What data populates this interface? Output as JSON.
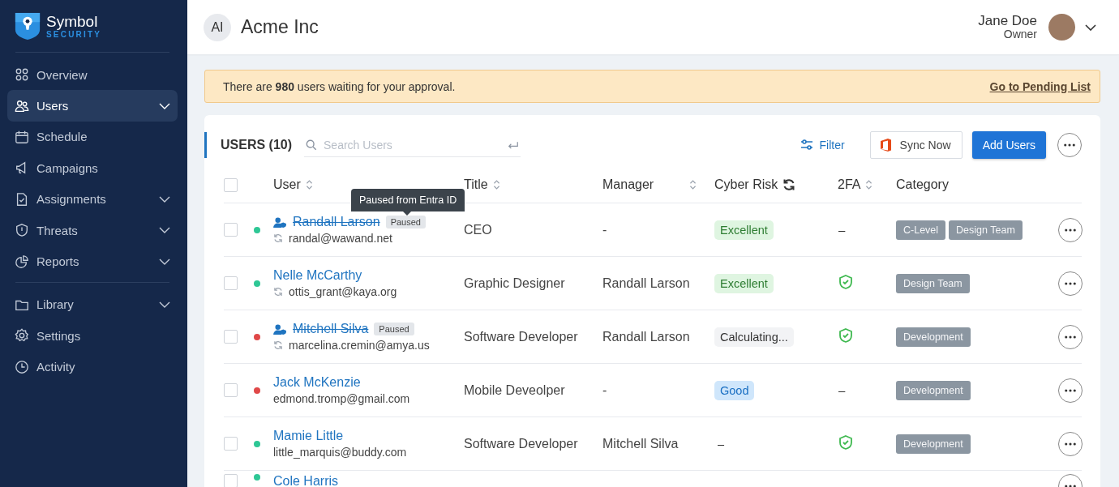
{
  "sidebar": {
    "logo": {
      "name": "Symbol",
      "tagline": "SECURITY"
    },
    "groups": [
      [
        {
          "label": "Overview",
          "selected": false,
          "submenu": false
        },
        {
          "label": "Users",
          "selected": true,
          "submenu": true
        },
        {
          "label": "Schedule",
          "selected": false,
          "submenu": false
        },
        {
          "label": "Campaigns",
          "selected": false,
          "submenu": false
        },
        {
          "label": "Assignments",
          "selected": false,
          "submenu": true
        },
        {
          "label": "Threats",
          "selected": false,
          "submenu": true
        },
        {
          "label": "Reports",
          "selected": false,
          "submenu": true
        }
      ],
      [
        {
          "label": "Library",
          "selected": false,
          "submenu": true
        },
        {
          "label": "Settings",
          "selected": false,
          "submenu": false
        },
        {
          "label": "Activity",
          "selected": false,
          "submenu": false
        }
      ]
    ]
  },
  "header": {
    "org": {
      "initials": "AI",
      "name": "Acme Inc"
    },
    "user": {
      "name": "Jane Doe",
      "role": "Owner"
    }
  },
  "banner": {
    "text": "There are **980** users waiting for your approval.",
    "link": "Go to Pending List"
  },
  "users_panel": {
    "title": "USERS (10)",
    "search": {
      "placeholder": "Search Users"
    },
    "filter": "Filter",
    "sync": "Sync Now",
    "add": "Add Users"
  },
  "table": {
    "all_selected": false,
    "columns": [
      {
        "label": "User",
        "kind": "sort"
      },
      {
        "label": "Title",
        "kind": "sort"
      },
      {
        "label": "Manager",
        "kind": "sort"
      },
      {
        "label": "Cyber Risk",
        "kind": "refresh"
      },
      {
        "label": "2FA",
        "kind": "sort"
      },
      {
        "label": "Category",
        "kind": "plain"
      }
    ],
    "rows": [
      {
        "selected": false,
        "color": "#2ec795",
        "paused": true,
        "badge": "Paused",
        "tooltip": "Paused from Entra ID",
        "name": "Randall Larson",
        "synced": true,
        "email": "randal@wawand.net",
        "title": "CEO",
        "manager": "-",
        "risk": {
          "kind": "excellent",
          "label": "Excellent"
        },
        "two_fa": {
          "on": false,
          "text": "–"
        },
        "categories": [
          "C-Level",
          "Design Team"
        ]
      },
      {
        "selected": false,
        "color": "#2ec795",
        "paused": false,
        "name": "Nelle McCarthy",
        "synced": true,
        "email": "ottis_grant@kaya.org",
        "title": "Graphic Designer",
        "manager": "Randall Larson",
        "risk": {
          "kind": "excellent",
          "label": "Excellent"
        },
        "two_fa": {
          "on": true
        },
        "categories": [
          "Design Team"
        ]
      },
      {
        "selected": false,
        "color": "#e04848",
        "paused": true,
        "badge": "Paused",
        "name": "Mitchell Silva",
        "synced": true,
        "email": "marcelina.cremin@amya.us",
        "title": "Software Developer",
        "manager": "Randall Larson",
        "risk": {
          "kind": "calculating",
          "label": "Calculating..."
        },
        "two_fa": {
          "on": true
        },
        "categories": [
          "Development"
        ]
      },
      {
        "selected": false,
        "color": "#e04848",
        "paused": false,
        "name": "Jack McKenzie",
        "synced": false,
        "email": "edmond.tromp@gmail.com",
        "title": "Mobile Deveolper",
        "manager": "-",
        "risk": {
          "kind": "good",
          "label": "Good"
        },
        "two_fa": {
          "on": false,
          "text": "–"
        },
        "categories": [
          "Development"
        ]
      },
      {
        "selected": false,
        "color": "#2ec795",
        "paused": false,
        "name": "Mamie Little",
        "synced": false,
        "email": "little_marquis@buddy.com",
        "title": "Software Developer",
        "manager": "Mitchell Silva",
        "risk": {
          "kind": "none",
          "label": "–"
        },
        "two_fa": {
          "on": true
        },
        "categories": [
          "Development"
        ]
      },
      {
        "selected": false,
        "color": "#2ec795",
        "paused": false,
        "name": "Cole Harris"
      }
    ]
  }
}
